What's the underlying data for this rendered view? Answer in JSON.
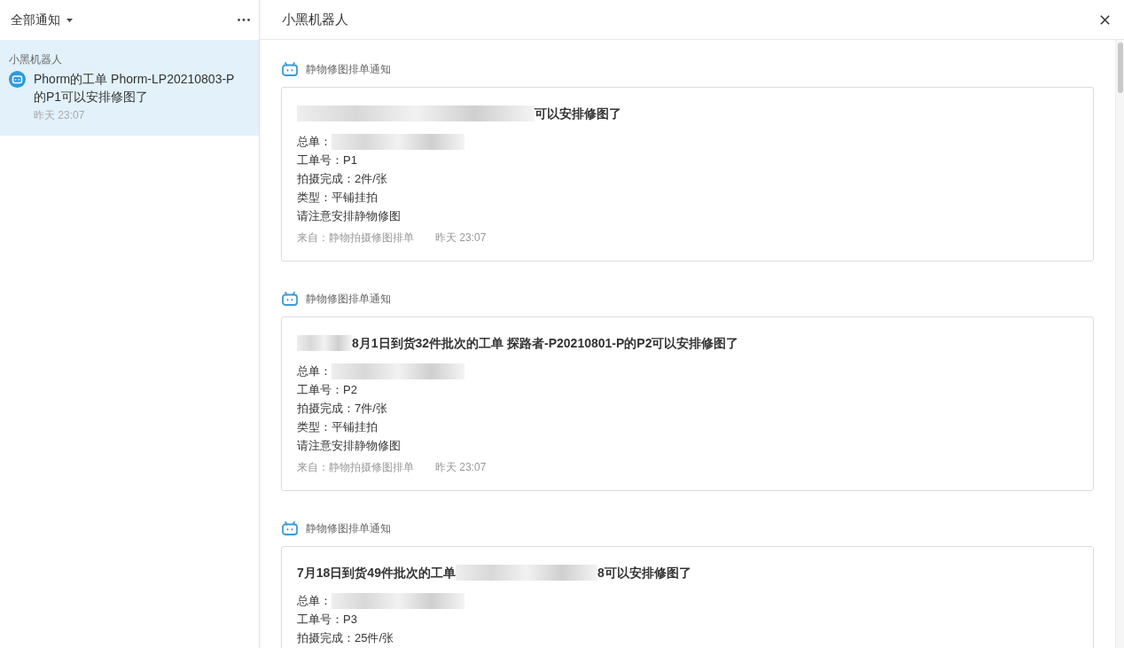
{
  "sidebar": {
    "filter": {
      "label": "全部通知"
    },
    "groups": [
      {
        "name": "小黑机器人",
        "items": [
          {
            "text": "Phorm的工单 Phorm-LP20210803-P的P1可以安排修图了",
            "time": "昨天 23:07",
            "selected": true
          }
        ]
      }
    ]
  },
  "conversation": {
    "title": "小黑机器人",
    "notifications": [
      {
        "source": "静物修图排单通知",
        "title": [
          {
            "kind": "redacted"
          },
          {
            "kind": "text",
            "text": "可以安排修图了"
          }
        ],
        "lines": [
          {
            "kind": "redacted",
            "text": "总单："
          },
          {
            "kind": "text",
            "text": "工单号：P1"
          },
          {
            "kind": "text",
            "text": "拍摄完成：2件/张"
          },
          {
            "kind": "text",
            "text": "类型：平铺挂拍"
          },
          {
            "kind": "text",
            "text": "请注意安排静物修图"
          }
        ],
        "from": "来自：静物拍摄修图排单",
        "time": "昨天 23:07"
      },
      {
        "source": "静物修图排单通知",
        "title": [
          {
            "kind": "redacted"
          },
          {
            "kind": "text",
            "text": "8月1日到货32件批次的工单 探路者-P20210801-P的P2可以安排修图了"
          }
        ],
        "lines": [
          {
            "kind": "redacted",
            "text": "总单："
          },
          {
            "kind": "text",
            "text": "工单号：P2"
          },
          {
            "kind": "text",
            "text": "拍摄完成：7件/张"
          },
          {
            "kind": "text",
            "text": "类型：平铺挂拍"
          },
          {
            "kind": "text",
            "text": "请注意安排静物修图"
          }
        ],
        "from": "来自：静物拍摄修图排单",
        "time": "昨天 23:07"
      },
      {
        "source": "静物修图排单通知",
        "title": [
          {
            "kind": "text",
            "text": "7月18日到货49件批次的工单"
          },
          {
            "kind": "redacted"
          },
          {
            "kind": "text",
            "text": "8可以安排修图了"
          }
        ],
        "lines": [
          {
            "kind": "redacted",
            "text": "总单："
          },
          {
            "kind": "text",
            "text": "工单号：P3"
          },
          {
            "kind": "text",
            "text": "拍摄完成：25件/张"
          }
        ]
      }
    ]
  }
}
